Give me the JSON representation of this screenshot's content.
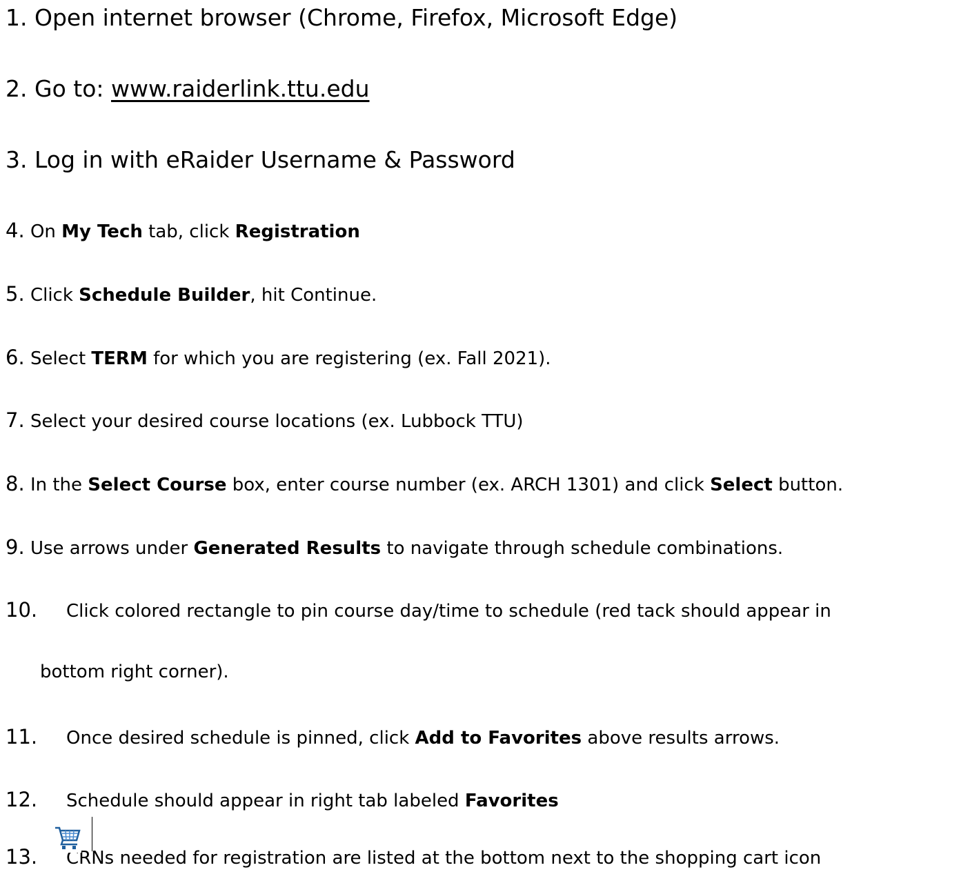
{
  "steps": [
    {
      "n": "1.",
      "parts": [
        {
          "t": "Open internet browser (Chrome, Firefox, Microsoft Edge)"
        }
      ]
    },
    {
      "n": "2.",
      "pre": "Go to: ",
      "link": "www.raiderlink.ttu.edu"
    },
    {
      "n": "3.",
      "parts": [
        {
          "t": "Log in with eRaider Username & Password"
        }
      ]
    },
    {
      "n": "4.",
      "a": "On ",
      "b1": "My Tech",
      "c": " tab, click ",
      "b2": "Registration"
    },
    {
      "n": "5.",
      "a": "Click ",
      "b1": "Schedule Builder",
      "c": ", hit Continue."
    },
    {
      "n": "6.",
      "a": "Select ",
      "b1": "TERM",
      "c": " for which you are registering (ex. Fall 2021)."
    },
    {
      "n": "7.",
      "a": "Select your desired course locations (ex. Lubbock TTU)"
    },
    {
      "n": "8.",
      "a": "In the ",
      "b1": "Select Course",
      "c": " box, enter course number (ex. ARCH 1301) and click ",
      "b2": "Select",
      "d": " button."
    },
    {
      "n": "9.",
      "a": "Use arrows under ",
      "b1": "Generated Results",
      "c": " to navigate through schedule combinations."
    },
    {
      "n": "10.",
      "a": "Click colored rectangle to pin course day/time to schedule (red tack should appear in",
      "cont": "bottom right corner)."
    },
    {
      "n": "11.",
      "a": "Once desired schedule is pinned, click ",
      "b1": "Add to Favorites",
      "c": " above results arrows."
    },
    {
      "n": "12.",
      "a": "Schedule should appear in right tab labeled ",
      "b1": "Favorites"
    },
    {
      "n": "13.",
      "a": "CRNs needed for registration are listed at the bottom next to the shopping cart icon"
    }
  ],
  "icons": {
    "cart": "shopping-cart-icon"
  }
}
